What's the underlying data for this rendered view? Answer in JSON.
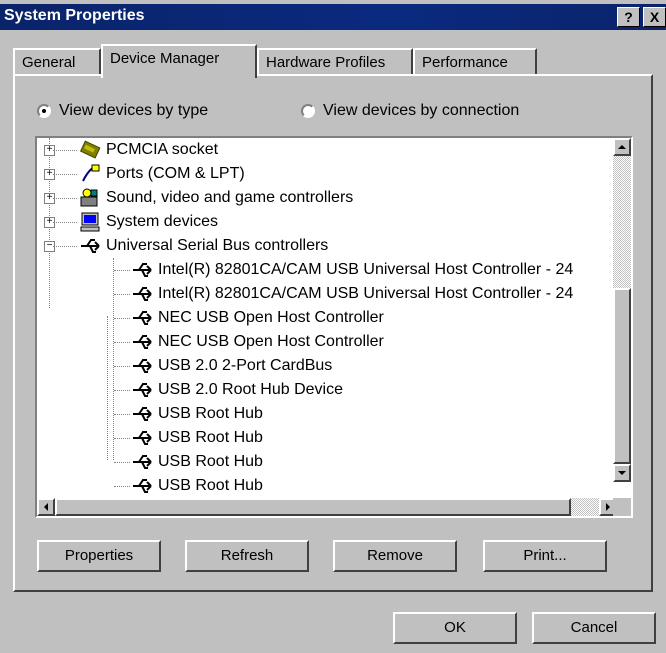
{
  "window": {
    "title": "System Properties",
    "help_label": "?",
    "close_label": "X"
  },
  "tabs": [
    {
      "label": "General",
      "active": false
    },
    {
      "label": "Device Manager",
      "active": true
    },
    {
      "label": "Hardware Profiles",
      "active": false
    },
    {
      "label": "Performance",
      "active": false
    }
  ],
  "view_options": {
    "by_type": {
      "label": "View devices by type",
      "checked": true
    },
    "by_connection": {
      "label": "View devices by connection",
      "checked": false
    }
  },
  "tree": {
    "categories": [
      {
        "label": "PCMCIA socket",
        "icon": "pcmcia-icon",
        "expanded": false
      },
      {
        "label": "Ports (COM & LPT)",
        "icon": "port-icon",
        "expanded": false
      },
      {
        "label": "Sound, video and game controllers",
        "icon": "sound-icon",
        "expanded": false
      },
      {
        "label": "System devices",
        "icon": "computer-icon",
        "expanded": false
      },
      {
        "label": "Universal Serial Bus controllers",
        "icon": "usb-icon",
        "expanded": true
      }
    ],
    "usb_devices": [
      "Intel(R) 82801CA/CAM USB Universal Host Controller - 24",
      "Intel(R) 82801CA/CAM USB Universal Host Controller - 24",
      "NEC USB Open Host Controller",
      "NEC USB Open Host Controller",
      "USB 2.0 2-Port CardBus",
      "USB 2.0 Root Hub Device",
      "USB Root Hub",
      "USB Root Hub",
      "USB Root Hub",
      "USB Root Hub"
    ]
  },
  "buttons": {
    "properties": "Properties",
    "refresh": "Refresh",
    "remove": "Remove",
    "print": "Print...",
    "ok": "OK",
    "cancel": "Cancel"
  }
}
